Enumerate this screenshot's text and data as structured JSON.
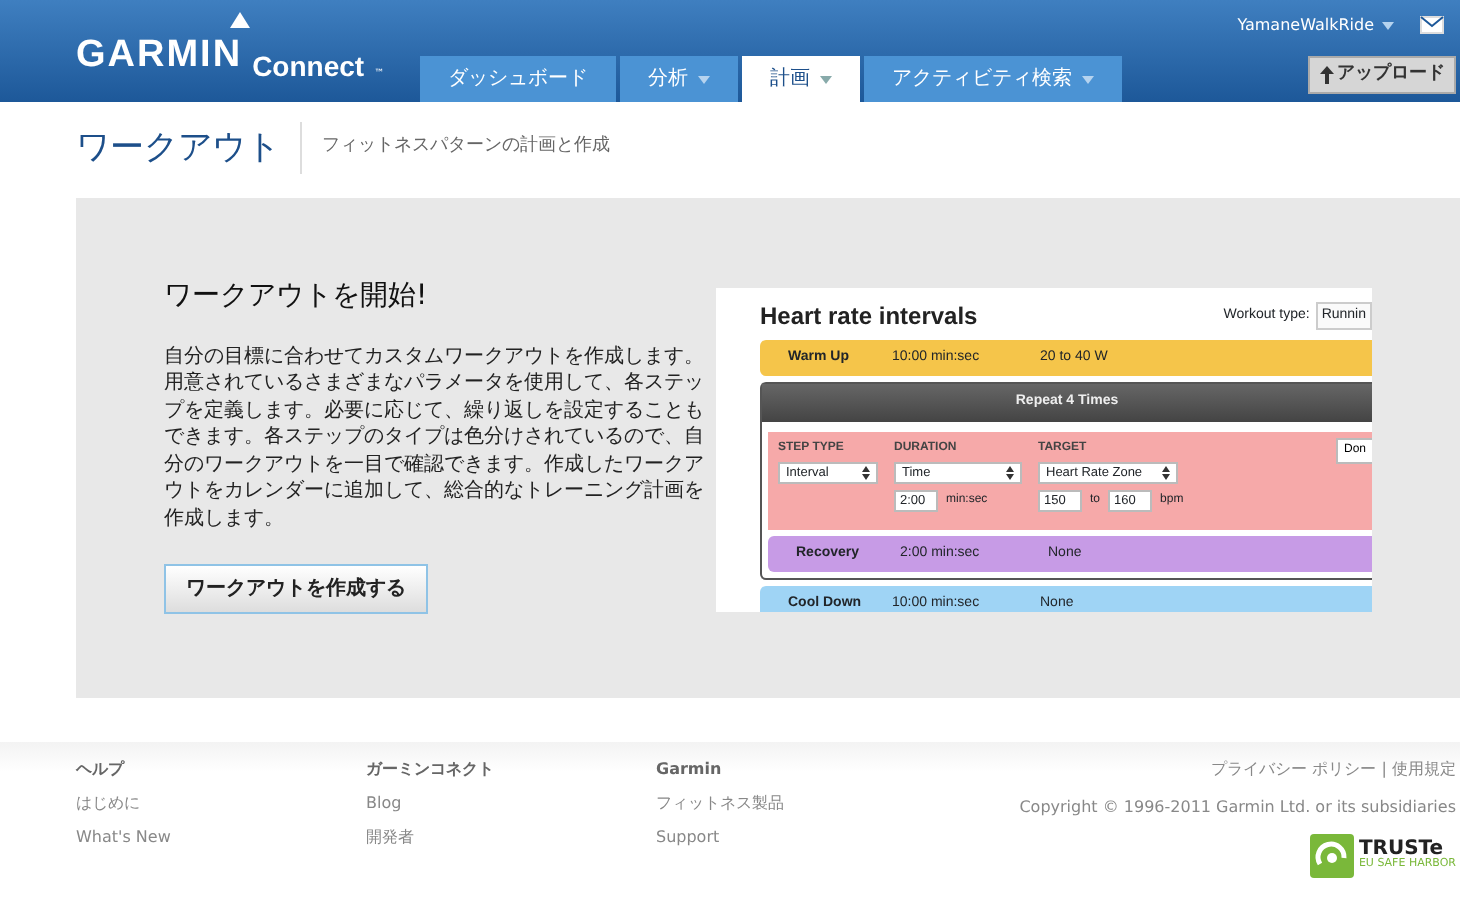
{
  "header": {
    "logo": {
      "brand": "GARMIN",
      "product": "Connect",
      "tm": "™"
    },
    "user_menu": "YamaneWalkRide",
    "tabs": [
      {
        "label": "ダッシュボード",
        "dropdown": false,
        "selected": false
      },
      {
        "label": "分析",
        "dropdown": true,
        "selected": false
      },
      {
        "label": "計画",
        "dropdown": true,
        "selected": true
      },
      {
        "label": "アクティビティ検索",
        "dropdown": true,
        "selected": false
      }
    ],
    "upload_button": "アップロード"
  },
  "page_header": {
    "title": "ワークアウト",
    "subtitle": "フィットネスパターンの計画と作成"
  },
  "hero": {
    "heading": "ワークアウトを開始!",
    "body": "自分の目標に合わせてカスタムワークアウトを作成します。用意されているさまざまなパラメータを使用して、各ステップを定義します。必要に応じて、繰り返しを設定することもできます。各ステップのタイプは色分けされているので、自分のワークアウトを一目で確認できます。作成したワークアウトをカレンダーに追加して、総合的なトレーニング計画を作成します。",
    "button": "ワークアウトを作成する"
  },
  "workout_preview": {
    "title": "Heart rate intervals",
    "type_label": "Workout type:",
    "type_value": "Runnin",
    "steps": [
      {
        "kind": "step",
        "color": "#f5c54a",
        "name": "Warm Up",
        "duration": "10:00 min:sec",
        "target": "20 to 40 W"
      },
      {
        "kind": "repeat",
        "label": "Repeat 4 Times",
        "editor": {
          "step_type_label": "STEP TYPE",
          "step_type": "Interval",
          "duration_label": "DURATION",
          "duration": "Time",
          "duration_value": "2:00",
          "duration_unit": "min:sec",
          "target_label": "TARGET",
          "target": "Heart Rate Zone",
          "target_from": "150",
          "to": "to",
          "target_to": "160",
          "target_unit": "bpm",
          "done": "Don"
        },
        "children": [
          {
            "kind": "step",
            "color": "#c79be6",
            "name": "Recovery",
            "duration": "2:00 min:sec",
            "target": "None"
          }
        ]
      },
      {
        "kind": "step",
        "color": "#9fd4f5",
        "name": "Cool Down",
        "duration": "10:00 min:sec",
        "target": "None"
      }
    ]
  },
  "footer": {
    "columns": [
      {
        "heading": "ヘルプ",
        "links": [
          "はじめに",
          "What's New"
        ]
      },
      {
        "heading": "ガーミンコネクト",
        "links": [
          "Blog",
          "開発者"
        ]
      },
      {
        "heading": "Garmin",
        "links": [
          "フィットネス製品",
          "Support"
        ]
      }
    ],
    "legal_links": [
      "プライバシー ポリシー",
      "使用規定"
    ],
    "separator": "|",
    "copyright": "Copyright © 1996-2011 Garmin Ltd. or its subsidiaries",
    "truste": {
      "name": "TRUSTe",
      "tagline": "EU SAFE HARBOR"
    }
  }
}
